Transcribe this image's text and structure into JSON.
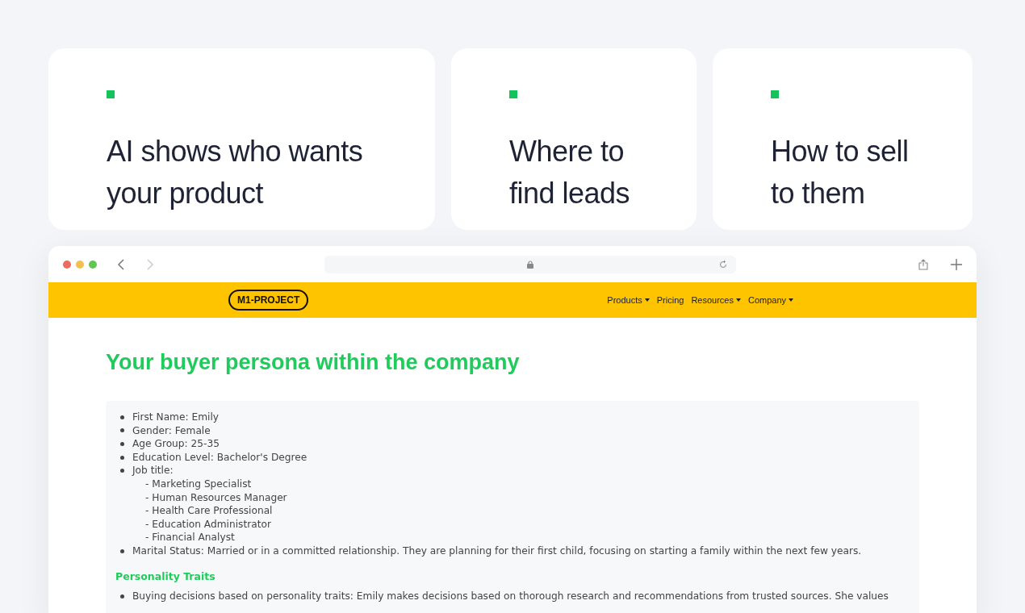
{
  "features": [
    {
      "title": "AI shows who wants your product"
    },
    {
      "title": "Where to find leads"
    },
    {
      "title": "How to sell to them"
    }
  ],
  "site": {
    "logo": "M1-PROJECT",
    "nav": [
      {
        "label": "Products",
        "dropdown": true
      },
      {
        "label": "Pricing",
        "dropdown": false
      },
      {
        "label": "Resources",
        "dropdown": true
      },
      {
        "label": "Company",
        "dropdown": true
      }
    ]
  },
  "heading": "Your buyer persona within the company",
  "sections": [
    {
      "items": [
        {
          "text": "First Name: Emily"
        },
        {
          "text": "Gender: Female"
        },
        {
          "text": "Age Group: 25-35"
        },
        {
          "text": "Education Level: Bachelor's Degree"
        },
        {
          "text": "Job title:",
          "children": [
            "- Marketing Specialist",
            "- Human Resources Manager",
            "- Health Care Professional",
            "- Education Administrator",
            "- Financial Analyst"
          ]
        },
        {
          "text": "Marital Status: Married or in a committed relationship. They are planning for their first child, focusing on starting a family within the next few years."
        }
      ]
    },
    {
      "title": "Personality Traits",
      "items": [
        {
          "text": "Buying decisions based on personality traits: Emily makes decisions based on thorough research and recommendations from trusted sources. She values"
        }
      ]
    }
  ]
}
